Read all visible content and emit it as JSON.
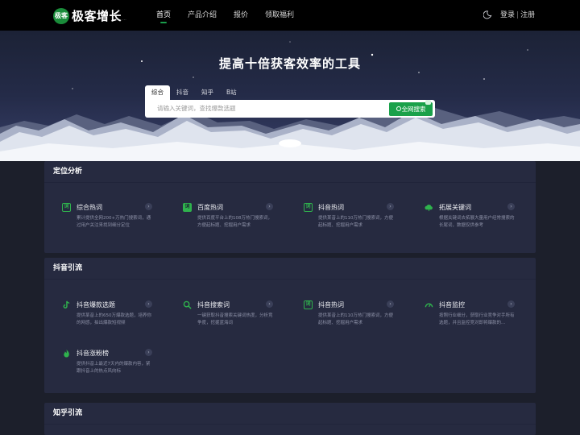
{
  "nav": {
    "logo_badge": "极客",
    "logo_text": "极客增长",
    "logo_sub": "...",
    "links": [
      "首页",
      "产品介绍",
      "报价",
      "领取福利"
    ],
    "login": "登录",
    "separator": "|",
    "register": "注册"
  },
  "hero": {
    "title": "提高十倍获客效率的工具",
    "tabs": [
      "综合",
      "抖音",
      "知乎",
      "B站"
    ],
    "search_placeholder": "请输入关键词，查找爆款选题",
    "search_button": "全网搜索"
  },
  "sections": [
    {
      "title": "定位分析",
      "cards": [
        {
          "title": "综合热词",
          "icon": "word-icon",
          "desc": "累计提供全网200+万热门搜索词，通过用户关注来找到细分定位"
        },
        {
          "title": "百度热词",
          "icon": "word-fill-icon",
          "desc": "提供百度平台上的108万热门搜索词，方便起标题、挖掘用户需求"
        },
        {
          "title": "抖音热词",
          "icon": "word-icon",
          "desc": "提供某音上的110万热门搜索词，方便起标题、挖掘用户需求"
        },
        {
          "title": "拓展关键词",
          "icon": "cloud-icon",
          "desc": "根据关键词去拓展大量用户经常搜索的长尾词，数据仅供参考"
        }
      ]
    },
    {
      "title": "抖音引流",
      "cards": [
        {
          "title": "抖音爆款选题",
          "icon": "tiktok-icon",
          "desc": "提供某音上的650万爆款选题，培养你的网感，拍出爆款短视频"
        },
        {
          "title": "抖音搜索词",
          "icon": "search-icon",
          "desc": "一键获取抖音搜索关键词热度，分析竞争度，挖掘蓝海词"
        },
        {
          "title": "抖音热词",
          "icon": "word-icon",
          "desc": "提供某音上的110万热门搜索词，方便起标题、挖掘用户需求"
        },
        {
          "title": "抖音监控",
          "icon": "gauge-icon",
          "desc": "按照行业细分，获取行业竞争对手所有选题，并且监控竞对即将爆款的..."
        },
        {
          "title": "抖音涨粉榜",
          "icon": "flame-icon",
          "desc": "提供抖音上最近7天内的爆款内容，紧跟抖音上的热点风向标"
        }
      ]
    },
    {
      "title": "知乎引流",
      "cards": []
    }
  ],
  "colors": {
    "accent": "#1aa14a",
    "panel": "#262a40",
    "page": "#1c1f2b"
  }
}
